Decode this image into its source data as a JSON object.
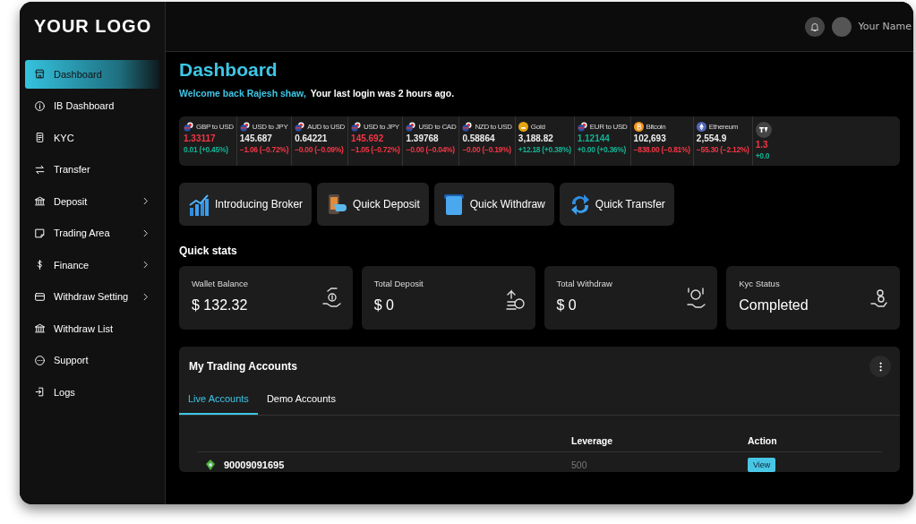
{
  "logo": "YOUR LOGO",
  "header": {
    "user_name": "Your Name"
  },
  "sidebar": {
    "items": [
      {
        "label": "Dashboard",
        "selected": true,
        "has_submenu": false
      },
      {
        "label": "IB Dashboard",
        "selected": false,
        "has_submenu": false
      },
      {
        "label": "KYC",
        "selected": false,
        "has_submenu": false
      },
      {
        "label": "Transfer",
        "selected": false,
        "has_submenu": false
      },
      {
        "label": "Deposit",
        "selected": false,
        "has_submenu": true
      },
      {
        "label": "Trading Area",
        "selected": false,
        "has_submenu": true
      },
      {
        "label": "Finance",
        "selected": false,
        "has_submenu": true
      },
      {
        "label": "Withdraw Setting",
        "selected": false,
        "has_submenu": true
      },
      {
        "label": "Withdraw List",
        "selected": false,
        "has_submenu": false
      },
      {
        "label": "Support",
        "selected": false,
        "has_submenu": false
      },
      {
        "label": "Logs",
        "selected": false,
        "has_submenu": false
      }
    ]
  },
  "page_title": "Dashboard",
  "welcome": {
    "greeting": "Welcome back Rajesh shaw,",
    "last_login": "Your last login was 2 hours ago."
  },
  "ticker": [
    {
      "kind": "fx",
      "label": "GBP to USD",
      "price": {
        "text": "1.33117",
        "color": "#f23645"
      },
      "change": {
        "text": "0.01 (+0.45%)",
        "color": "#13b294"
      }
    },
    {
      "kind": "fx",
      "label": "USD to JPY",
      "price": {
        "text": "145.687",
        "color": "#eeeeee"
      },
      "change": {
        "text": "−1.06 (−0.72%)",
        "color": "#f23645"
      }
    },
    {
      "kind": "fx",
      "label": "AUD to USD",
      "price": {
        "text": "0.64221",
        "color": "#eeeeee"
      },
      "change": {
        "text": "−0.00 (−0.09%)",
        "color": "#f23645"
      }
    },
    {
      "kind": "fx",
      "label": "USD to JPY",
      "price": {
        "text": "145.692",
        "color": "#f23645"
      },
      "change": {
        "text": "−1.05 (−0.72%)",
        "color": "#f23645"
      }
    },
    {
      "kind": "fx",
      "label": "USD to CAD",
      "price": {
        "text": "1.39768",
        "color": "#eeeeee"
      },
      "change": {
        "text": "−0.00 (−0.04%)",
        "color": "#f23645"
      }
    },
    {
      "kind": "fx",
      "label": "NZD to USD",
      "price": {
        "text": "0.58864",
        "color": "#eeeeee"
      },
      "change": {
        "text": "−0.00 (−0.19%)",
        "color": "#f23645"
      }
    },
    {
      "kind": "gold",
      "label": "Gold",
      "price": {
        "text": "3,188.82",
        "color": "#eeeeee"
      },
      "change": {
        "text": "+12.18 (+0.38%)",
        "color": "#13b294"
      }
    },
    {
      "kind": "fx",
      "label": "EUR to USD",
      "price": {
        "text": "1.12144",
        "color": "#13b294"
      },
      "change": {
        "text": "+0.00 (+0.36%)",
        "color": "#13b294"
      }
    },
    {
      "kind": "bitcoin",
      "label": "Bitcoin",
      "price": {
        "text": "102,693",
        "color": "#eeeeee"
      },
      "change": {
        "text": "−838.00 (−0.81%)",
        "color": "#f23645"
      }
    },
    {
      "kind": "ethereum",
      "label": "Ethereum",
      "price": {
        "text": "2,554.9",
        "color": "#eeeeee"
      },
      "change": {
        "text": "−55.30 (−2.12%)",
        "color": "#f23645"
      }
    },
    {
      "kind": "brand",
      "price": {
        "text": "1.3",
        "color": "#f23645"
      },
      "change": {
        "text": "+0.0",
        "color": "#13b294"
      }
    }
  ],
  "quick_actions": [
    {
      "label": "Introducing Broker"
    },
    {
      "label": "Quick Deposit"
    },
    {
      "label": "Quick Withdraw"
    },
    {
      "label": "Quick Transfer"
    }
  ],
  "quick_stats": {
    "title": "Quick stats",
    "cards": [
      {
        "label": "Wallet Balance",
        "value": "$ 132.32"
      },
      {
        "label": "Total Deposit",
        "value": "$ 0"
      },
      {
        "label": "Total Withdraw",
        "value": "$ 0"
      },
      {
        "label": "Kyc Status",
        "value": "Completed"
      }
    ]
  },
  "trading_accounts": {
    "title": "My Trading Accounts",
    "tabs": [
      {
        "label": "Live Accounts",
        "selected": true
      },
      {
        "label": "Demo Accounts",
        "selected": false
      }
    ],
    "columns": [
      "Leverage",
      "Action"
    ],
    "rows": [
      {
        "account": "90009091695",
        "leverage": "500",
        "action": "View"
      }
    ]
  }
}
